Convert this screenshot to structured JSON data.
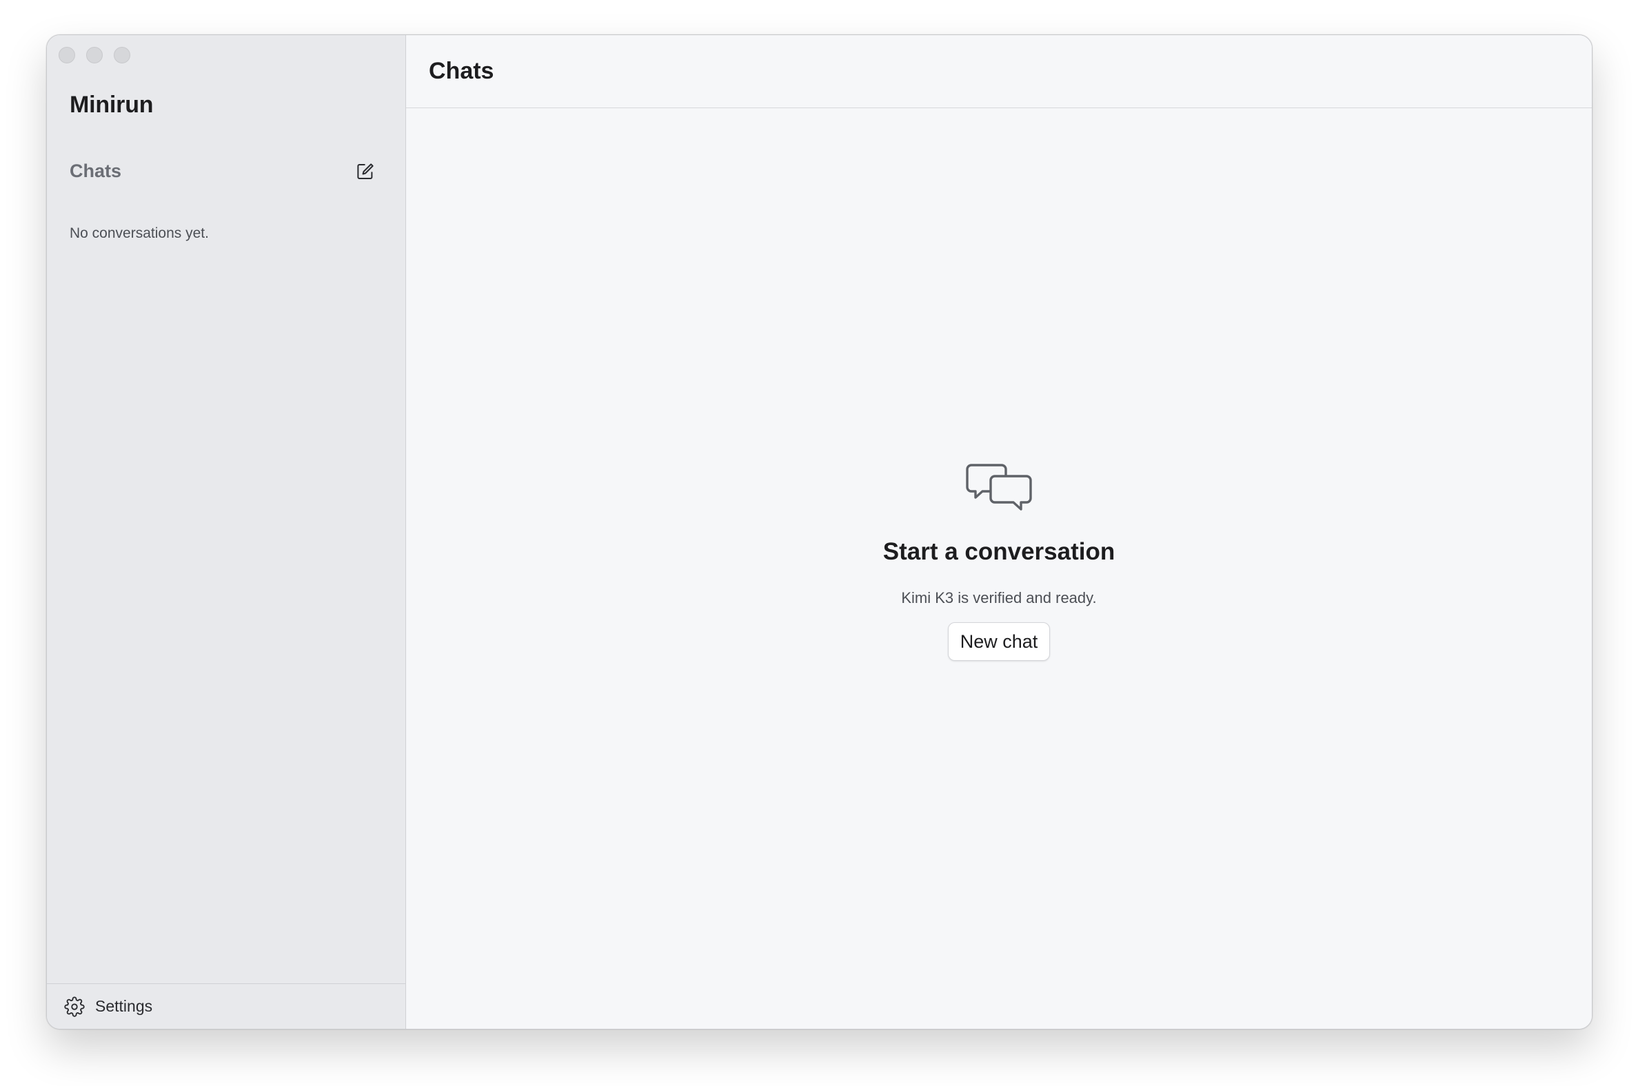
{
  "sidebar": {
    "app_name": "Minirun",
    "section_title": "Chats",
    "compose_icon": "compose-icon",
    "empty_text": "No conversations yet.",
    "settings_icon": "gear-icon",
    "settings_label": "Settings"
  },
  "main": {
    "title": "Chats",
    "empty_state": {
      "icon": "chat-bubbles-icon",
      "title": "Start a conversation",
      "subtitle": "Kimi K3 is verified and ready.",
      "button_label": "New chat"
    }
  },
  "colors": {
    "sidebar_bg": "#e8e9ec",
    "main_bg": "#f6f7f9",
    "text_primary": "#1d1d1f",
    "text_secondary": "#6b6e75"
  }
}
